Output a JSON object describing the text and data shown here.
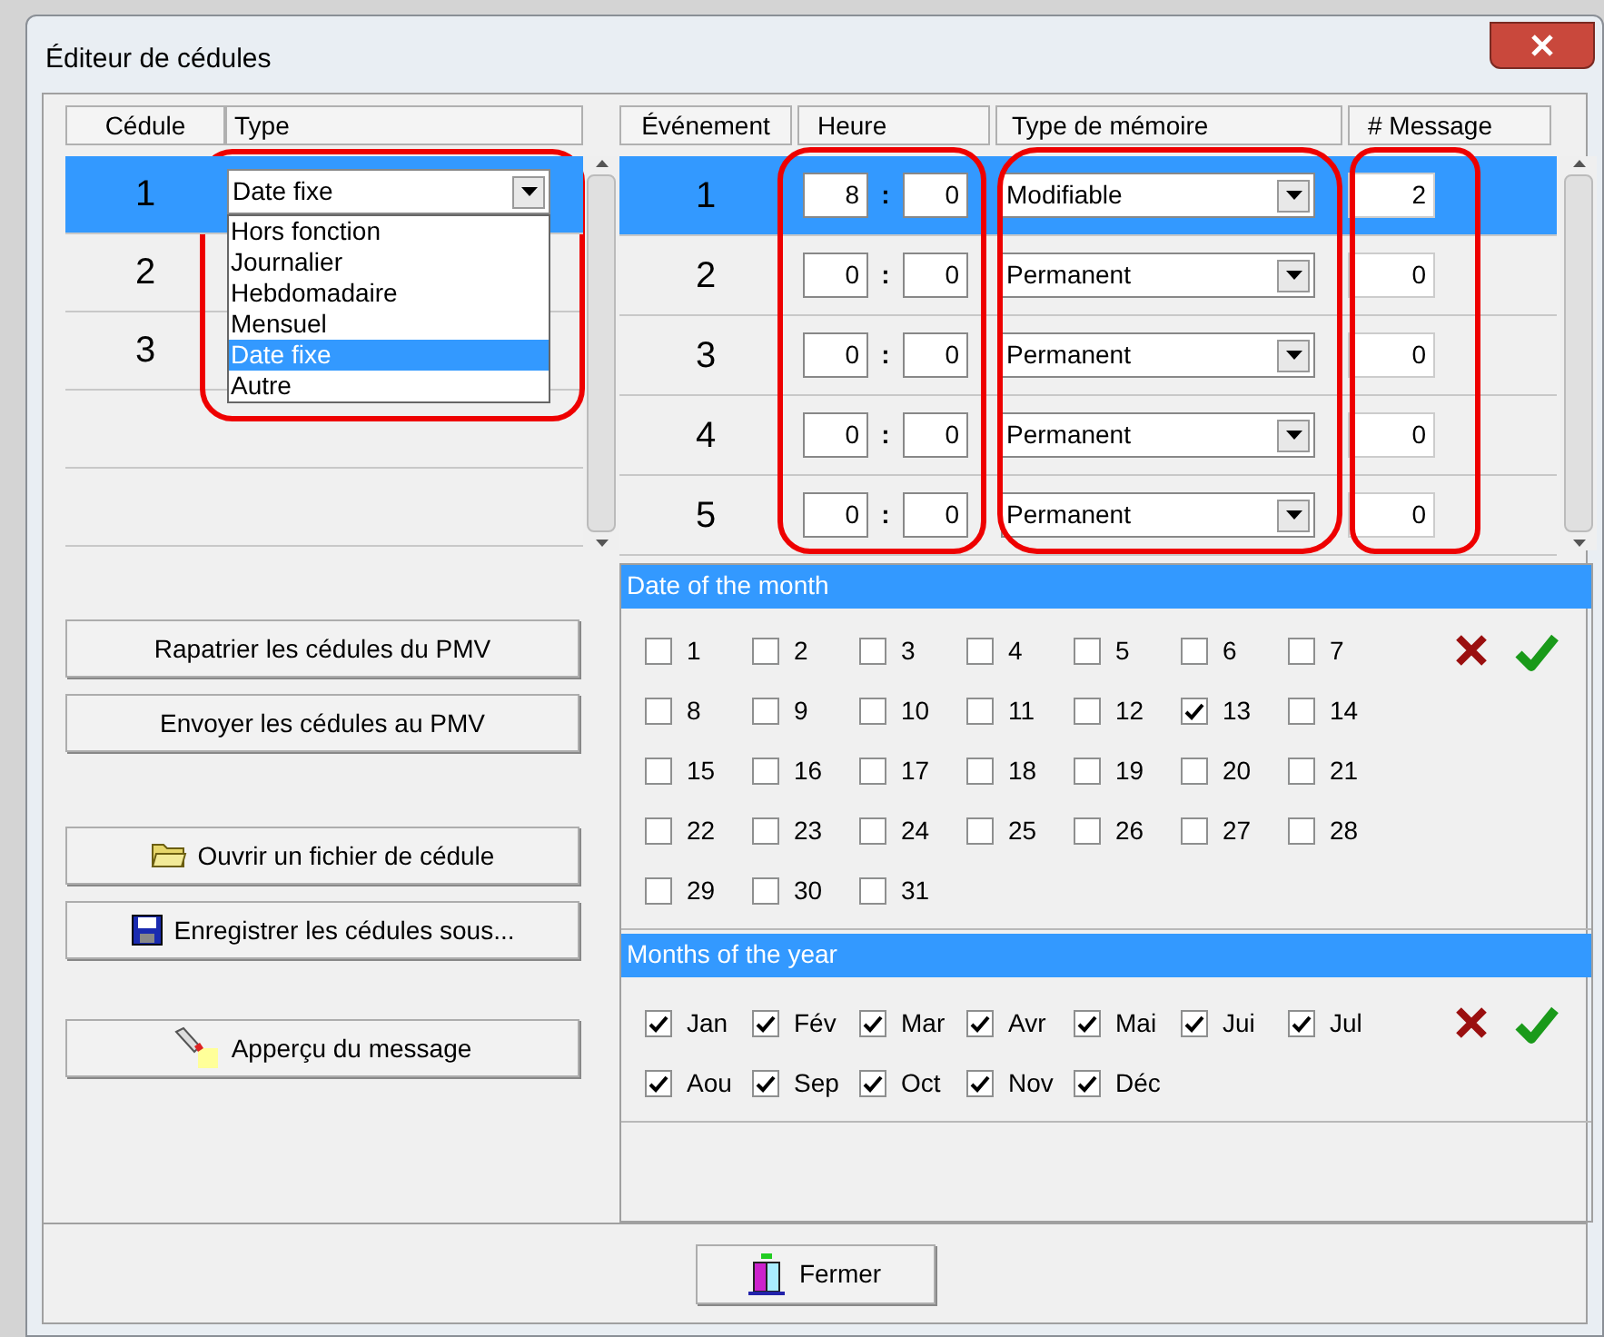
{
  "window": {
    "title": "Éditeur de cédules"
  },
  "schedules": {
    "columns": [
      "Cédule",
      "Type"
    ],
    "rows": [
      {
        "number": "1",
        "selected": true
      },
      {
        "number": "2",
        "selected": false
      },
      {
        "number": "3",
        "selected": false
      }
    ],
    "type_dropdown": {
      "value": "Date fixe",
      "expanded": true,
      "options": [
        {
          "label": "Hors fonction",
          "selected": false
        },
        {
          "label": "Journalier",
          "selected": false
        },
        {
          "label": "Hebdomadaire",
          "selected": false
        },
        {
          "label": "Mensuel",
          "selected": false
        },
        {
          "label": "Date fixe",
          "selected": true
        },
        {
          "label": "Autre",
          "selected": false
        }
      ]
    }
  },
  "events": {
    "columns": [
      "Événement",
      "Heure",
      "Type de mémoire",
      "# Message"
    ],
    "rows": [
      {
        "number": "1",
        "hour": "8",
        "minute": "0",
        "separator": ":",
        "memory_type": "Modifiable",
        "message": "2",
        "selected": true
      },
      {
        "number": "2",
        "hour": "0",
        "minute": "0",
        "separator": ":",
        "memory_type": "Permanent",
        "message": "0",
        "selected": false
      },
      {
        "number": "3",
        "hour": "0",
        "minute": "0",
        "separator": ":",
        "memory_type": "Permanent",
        "message": "0",
        "selected": false
      },
      {
        "number": "4",
        "hour": "0",
        "minute": "0",
        "separator": ":",
        "memory_type": "Permanent",
        "message": "0",
        "selected": false
      },
      {
        "number": "5",
        "hour": "0",
        "minute": "0",
        "separator": ":",
        "memory_type": "Permanent",
        "message": "0",
        "selected": false
      }
    ]
  },
  "date_of_month": {
    "title": "Date of the month",
    "days": [
      {
        "label": "1",
        "checked": false
      },
      {
        "label": "2",
        "checked": false
      },
      {
        "label": "3",
        "checked": false
      },
      {
        "label": "4",
        "checked": false
      },
      {
        "label": "5",
        "checked": false
      },
      {
        "label": "6",
        "checked": false
      },
      {
        "label": "7",
        "checked": false
      },
      {
        "label": "8",
        "checked": false
      },
      {
        "label": "9",
        "checked": false
      },
      {
        "label": "10",
        "checked": false
      },
      {
        "label": "11",
        "checked": false
      },
      {
        "label": "12",
        "checked": false
      },
      {
        "label": "13",
        "checked": true
      },
      {
        "label": "14",
        "checked": false
      },
      {
        "label": "15",
        "checked": false
      },
      {
        "label": "16",
        "checked": false
      },
      {
        "label": "17",
        "checked": false
      },
      {
        "label": "18",
        "checked": false
      },
      {
        "label": "19",
        "checked": false
      },
      {
        "label": "20",
        "checked": false
      },
      {
        "label": "21",
        "checked": false
      },
      {
        "label": "22",
        "checked": false
      },
      {
        "label": "23",
        "checked": false
      },
      {
        "label": "24",
        "checked": false
      },
      {
        "label": "25",
        "checked": false
      },
      {
        "label": "26",
        "checked": false
      },
      {
        "label": "27",
        "checked": false
      },
      {
        "label": "28",
        "checked": false
      },
      {
        "label": "29",
        "checked": false
      },
      {
        "label": "30",
        "checked": false
      },
      {
        "label": "31",
        "checked": false
      }
    ]
  },
  "months_of_year": {
    "title": "Months of the year",
    "months": [
      {
        "label": "Jan",
        "checked": true
      },
      {
        "label": "Fév",
        "checked": true
      },
      {
        "label": "Mar",
        "checked": true
      },
      {
        "label": "Avr",
        "checked": true
      },
      {
        "label": "Mai",
        "checked": true
      },
      {
        "label": "Jui",
        "checked": true
      },
      {
        "label": "Jul",
        "checked": true
      },
      {
        "label": "Aou",
        "checked": true
      },
      {
        "label": "Sep",
        "checked": true
      },
      {
        "label": "Oct",
        "checked": true
      },
      {
        "label": "Nov",
        "checked": true
      },
      {
        "label": "Déc",
        "checked": true
      }
    ]
  },
  "action_buttons": [
    {
      "label": "Rapatrier les cédules du PMV"
    },
    {
      "label": "Envoyer les cédules au PMV"
    },
    {
      "label": "Ouvrir un fichier de cédule"
    },
    {
      "label": "Enregistrer les cédules sous..."
    },
    {
      "label": "Apperçu du message"
    }
  ],
  "close_button": {
    "label": "Fermer"
  }
}
